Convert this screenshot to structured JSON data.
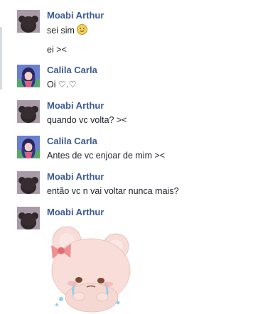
{
  "messages": [
    {
      "sender": "Moabi Arthur",
      "avatar": "moabi-avatar",
      "lines": [
        "sei sim",
        "ei ><"
      ],
      "emoji": "smiley-icon"
    },
    {
      "sender": "Calila Carla",
      "avatar": "calila-avatar",
      "lines": [
        "Oi ♡.♡"
      ]
    },
    {
      "sender": "Moabi Arthur",
      "avatar": "moabi-avatar",
      "lines": [
        "quando vc volta? ><"
      ]
    },
    {
      "sender": "Calila Carla",
      "avatar": "calila-avatar",
      "lines": [
        "Antes de vc enjoar de mim ><"
      ]
    },
    {
      "sender": "Moabi Arthur",
      "avatar": "moabi-avatar",
      "lines": [
        "então vc n vai voltar nunca mais?"
      ]
    },
    {
      "sender": "Moabi Arthur",
      "avatar": "moabi-avatar",
      "lines": [],
      "sticker": "crying-bear-sticker"
    }
  ],
  "colors": {
    "sender_name": "#3b5998",
    "message_text": "#1d2129",
    "background": "#ffffff"
  }
}
